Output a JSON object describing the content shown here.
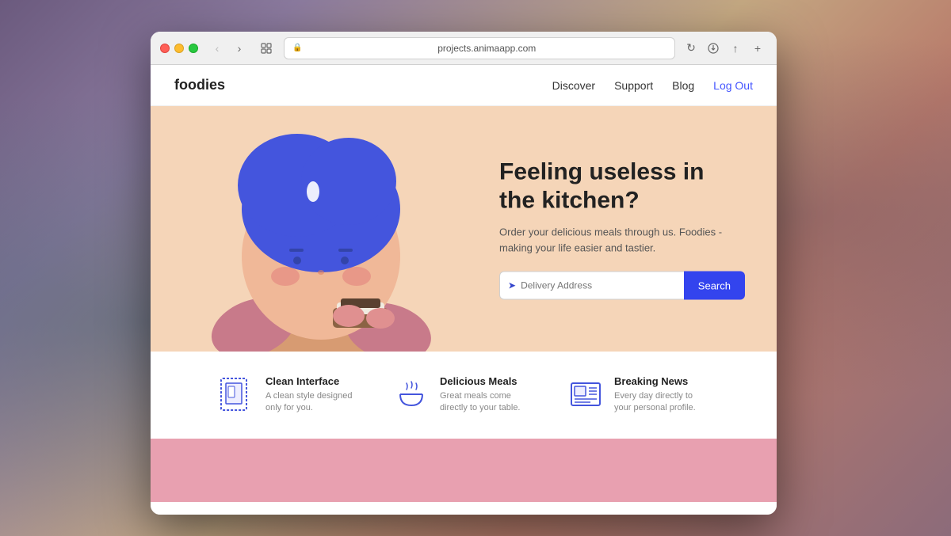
{
  "desktop": {
    "bg_description": "macOS Catalina wallpaper"
  },
  "browser": {
    "url": "projects.animaapp.com",
    "tab_icon": "⊞"
  },
  "nav": {
    "logo": "foodies",
    "links": [
      "Discover",
      "Support",
      "Blog",
      "Log Out"
    ]
  },
  "hero": {
    "heading": "Feeling useless in the kitchen?",
    "subtext": "Order your delicious meals through us. Foodies - making your life easier and tastier.",
    "search_placeholder": "Delivery Address",
    "search_button": "Search"
  },
  "features": [
    {
      "icon": "clean-interface-icon",
      "title": "Clean Interface",
      "desc": "A clean style designed only for you."
    },
    {
      "icon": "delicious-meals-icon",
      "title": "Delicious Meals",
      "desc": "Great meals come directly to your table."
    },
    {
      "icon": "breaking-news-icon",
      "title": "Breaking News",
      "desc": "Every day directly to your personal profile."
    }
  ],
  "toolbar": {
    "back_label": "‹",
    "forward_label": "›",
    "reload_label": "↻",
    "share_label": "↑",
    "new_tab_label": "+"
  }
}
